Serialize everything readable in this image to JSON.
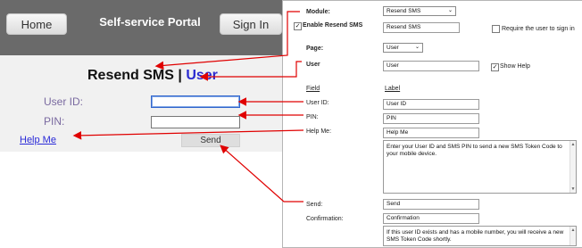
{
  "preview": {
    "home_button": "Home",
    "portal_title": "Self-service Portal",
    "signin_button": "Sign In",
    "heading_module": "Resend SMS",
    "heading_separator": "|",
    "heading_page": "User",
    "user_id_label": "User ID:",
    "pin_label": "PIN:",
    "help_link": "Help Me",
    "send_button": "Send"
  },
  "panel": {
    "module_label": "Module:",
    "module_value": "Resend SMS",
    "enable_label": "Enable Resend SMS",
    "enable_checked": true,
    "module_name_value": "Resend SMS",
    "require_signin_label": "Require the user to sign in",
    "require_signin_checked": false,
    "page_label": "Page:",
    "page_value": "User",
    "user_label": "User",
    "user_value": "User",
    "show_help_label": "Show Help",
    "show_help_checked": true,
    "field_header": "Field",
    "label_header": "Label",
    "rows": [
      {
        "field": "User ID:",
        "label": "User ID"
      },
      {
        "field": "PIN:",
        "label": "PIN"
      },
      {
        "field": "Help Me:",
        "label": "Help Me"
      }
    ],
    "help_text": "Enter your User ID and SMS PIN to send a new SMS Token Code to your mobile device.",
    "send_field": "Send:",
    "send_value": "Send",
    "confirmation_field": "Confirmation:",
    "confirmation_value": "Confirmation",
    "confirmation_text": "If this user ID exists and has a mobile number, you will receive a new SMS Token Code shortly."
  },
  "colors": {
    "header_bg": "#6a6a6a",
    "form_bg": "#f1f1f1",
    "link_blue": "#2a2ad8",
    "arrow_red": "#e00000"
  }
}
